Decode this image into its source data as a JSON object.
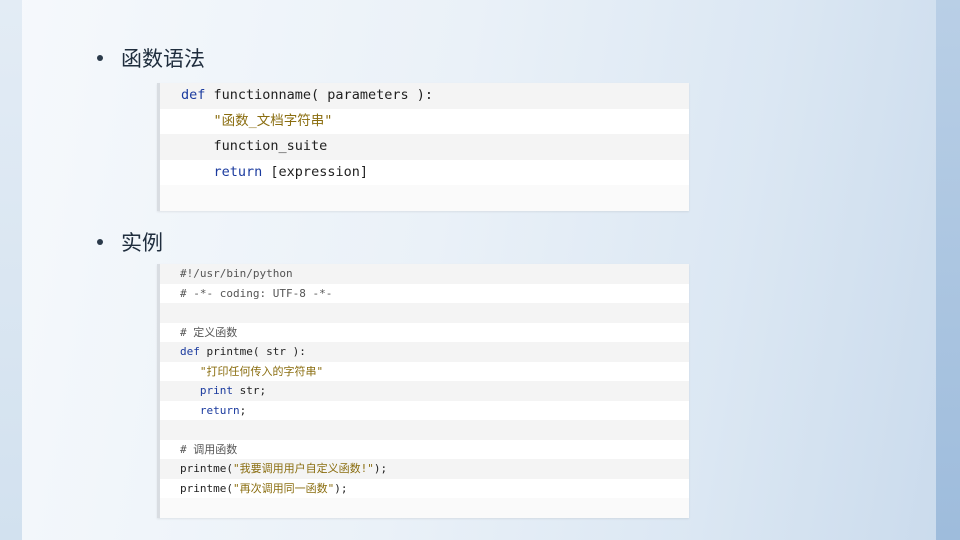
{
  "sections": [
    {
      "heading": "函数语法",
      "code_lines": [
        [
          {
            "t": "def",
            "c": "kw"
          },
          {
            "t": " functionname( parameters ):",
            "c": "plain"
          }
        ],
        [
          {
            "t": "    ",
            "c": "plain"
          },
          {
            "t": "\"函数_文档字符串\"",
            "c": "str"
          }
        ],
        [
          {
            "t": "    function_suite",
            "c": "plain"
          }
        ],
        [
          {
            "t": "    ",
            "c": "plain"
          },
          {
            "t": "return",
            "c": "kw"
          },
          {
            "t": " [expression]",
            "c": "plain"
          }
        ]
      ]
    },
    {
      "heading": "实例",
      "code_lines": [
        [
          {
            "t": "#!/usr/bin/python",
            "c": "cm"
          }
        ],
        [
          {
            "t": "# -*- coding: UTF-8 -*-",
            "c": "cm"
          }
        ],
        [
          {
            "t": "",
            "c": "plain"
          }
        ],
        [
          {
            "t": "# 定义函数",
            "c": "cm"
          }
        ],
        [
          {
            "t": "def",
            "c": "kw"
          },
          {
            "t": " printme( str ):",
            "c": "plain"
          }
        ],
        [
          {
            "t": "   ",
            "c": "plain"
          },
          {
            "t": "\"打印任何传入的字符串\"",
            "c": "str"
          }
        ],
        [
          {
            "t": "   ",
            "c": "plain"
          },
          {
            "t": "print",
            "c": "kw"
          },
          {
            "t": " str;",
            "c": "plain"
          }
        ],
        [
          {
            "t": "   ",
            "c": "plain"
          },
          {
            "t": "return",
            "c": "kw"
          },
          {
            "t": ";",
            "c": "plain"
          }
        ],
        [
          {
            "t": "",
            "c": "plain"
          }
        ],
        [
          {
            "t": "# 调用函数",
            "c": "cm"
          }
        ],
        [
          {
            "t": "printme(",
            "c": "plain"
          },
          {
            "t": "\"我要调用用户自定义函数!\"",
            "c": "str"
          },
          {
            "t": ");",
            "c": "plain"
          }
        ],
        [
          {
            "t": "printme(",
            "c": "plain"
          },
          {
            "t": "\"再次调用同一函数\"",
            "c": "str"
          },
          {
            "t": ");",
            "c": "plain"
          }
        ]
      ]
    }
  ]
}
